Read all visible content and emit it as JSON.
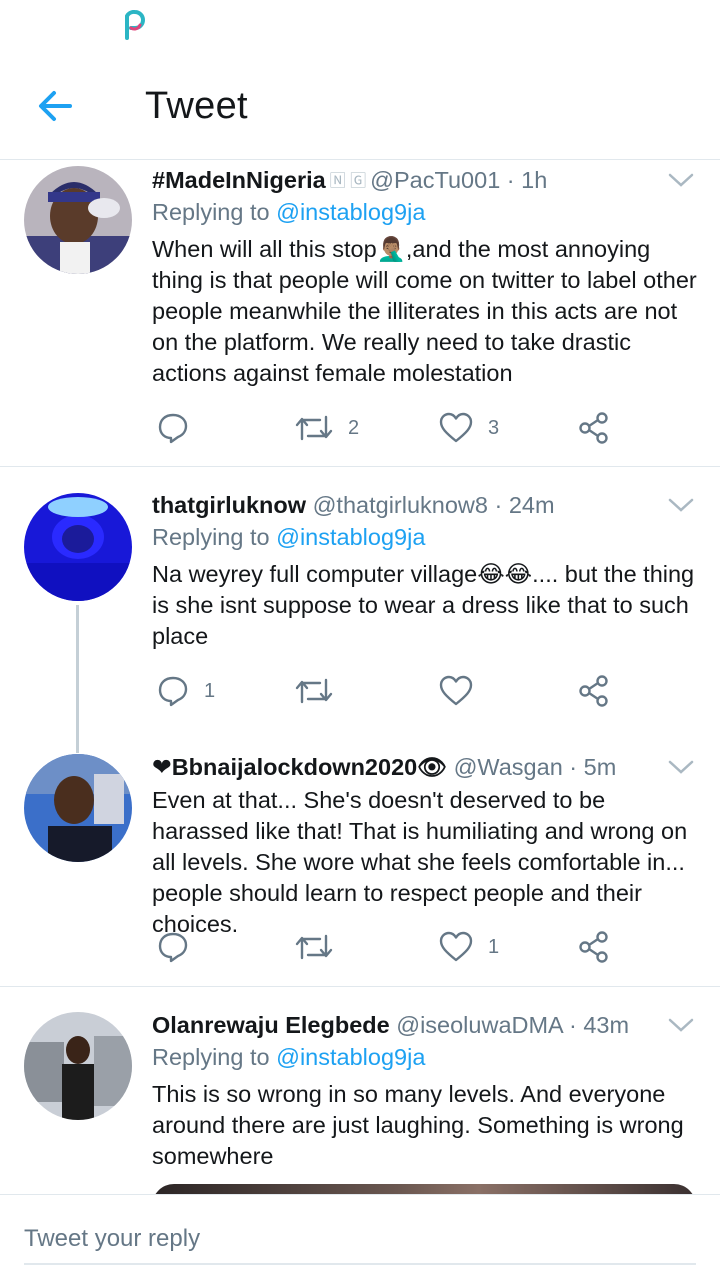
{
  "appbar": {
    "title": "Tweet",
    "back_icon": "arrow-left-icon"
  },
  "colors": {
    "accent": "#1da1f2",
    "text": "#14171a",
    "muted": "#657786",
    "divider": "#e1e8ed"
  },
  "tweets": [
    {
      "name": "#MadeInNigeria",
      "badge": "🄽 🄶",
      "handle": "@PacTu001 · 1h",
      "reply_prefix": "Replying to",
      "reply_to": "@instablog9ja",
      "text": "When will all this stop🤦🏽‍♂️,and the most annoying thing is that people will come on twitter to label other people meanwhile the illiterates in this acts are not on the platform. We really need to take drastic actions against female molestation",
      "reply_count": "",
      "retweet_count": "2",
      "like_count": "3"
    },
    {
      "name": "thatgirluknow",
      "handle": "@thatgirluknow8 · 24m",
      "reply_prefix": "Replying to",
      "reply_to": "@instablog9ja",
      "text": "Na weyrey full computer village😂😂.... but the thing is she isnt suppose to wear a dress like that to such place",
      "reply_count": "1",
      "retweet_count": "",
      "like_count": ""
    },
    {
      "name": "❤Bbnaijalockdown2020👁",
      "handle": "@Wasgan · 5m",
      "text": "Even at that... She's doesn't deserved to be harassed like that! That is humiliating and wrong on all levels. She wore what she feels comfortable in... people should learn to respect people and their choices.",
      "reply_count": "",
      "retweet_count": "",
      "like_count": "1"
    },
    {
      "name": "Olanrewaju Elegbede",
      "handle": "@iseoluwaDMA · 43m",
      "reply_prefix": "Replying to",
      "reply_to": "@instablog9ja",
      "text": "This is so wrong in so many levels. And everyone around there are just laughing. Something is wrong somewhere"
    }
  ],
  "composer": {
    "placeholder": "Tweet your reply"
  }
}
